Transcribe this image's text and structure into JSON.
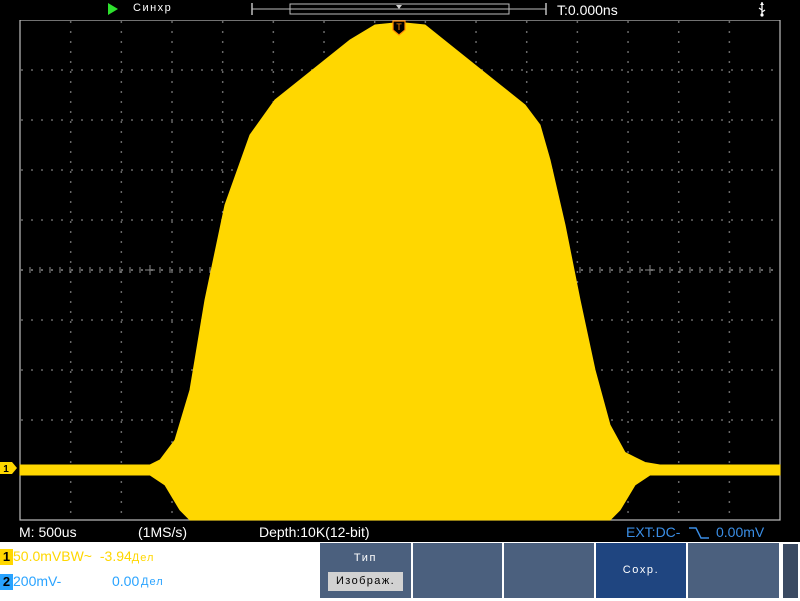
{
  "top": {
    "trigger_status": "Синхр",
    "time_offset": "T:0.000ns",
    "run_state_icon": "run-play-icon",
    "usb_icon": "usb-icon"
  },
  "markers": {
    "trigger_level": "T",
    "channel_ref": "1"
  },
  "colors": {
    "ch1": "#ffd700",
    "ch2": "#29a3ff",
    "ext": "#3a8ee6",
    "menu_bg": "#4b607e",
    "menu_selected": "#1f4580",
    "grid": "#8a8a8a"
  },
  "waveform": {
    "channel": 1,
    "baseline_div": -4,
    "baseline_noise_div": 0.1,
    "envelope_upper": [
      [
        -7.6,
        -3.9
      ],
      [
        -5.0,
        -3.9
      ],
      [
        -4.8,
        -3.8
      ],
      [
        -4.5,
        -3.4
      ],
      [
        -4.2,
        -2.4
      ],
      [
        -3.9,
        -0.6
      ],
      [
        -3.5,
        1.3
      ],
      [
        -3.0,
        2.7
      ],
      [
        -2.5,
        3.4
      ],
      [
        -2.0,
        3.8
      ],
      [
        -1.5,
        4.2
      ],
      [
        -1.0,
        4.6
      ],
      [
        -0.5,
        4.9
      ],
      [
        0.0,
        4.95
      ],
      [
        0.5,
        4.9
      ],
      [
        1.0,
        4.5
      ],
      [
        1.5,
        4.1
      ],
      [
        2.0,
        3.7
      ],
      [
        2.5,
        3.3
      ],
      [
        2.8,
        2.9
      ],
      [
        3.0,
        2.2
      ],
      [
        3.3,
        0.9
      ],
      [
        3.6,
        -0.6
      ],
      [
        3.9,
        -2.0
      ],
      [
        4.2,
        -3.1
      ],
      [
        4.5,
        -3.65
      ],
      [
        4.9,
        -3.85
      ],
      [
        5.2,
        -3.9
      ],
      [
        7.6,
        -3.9
      ]
    ],
    "envelope_lower": [
      [
        -7.6,
        -4.1
      ],
      [
        -5.0,
        -4.1
      ],
      [
        -4.7,
        -4.3
      ],
      [
        -4.4,
        -4.8
      ],
      [
        -4.2,
        -5.0
      ],
      [
        4.2,
        -5.0
      ],
      [
        4.4,
        -4.8
      ],
      [
        4.7,
        -4.3
      ],
      [
        5.0,
        -4.1
      ],
      [
        7.6,
        -4.1
      ]
    ]
  },
  "status": {
    "timebase": "M: 500us",
    "sample_rate": "(1MS/s)",
    "depth": "Depth:10K(12-bit)",
    "trigger_source": "EXT:DC-",
    "trigger_level": "0.00mV"
  },
  "channels": [
    {
      "num": "1",
      "scale": "50.0mV",
      "coupling": "BW~",
      "offset": "-3.94",
      "offset_unit": "Дел"
    },
    {
      "num": "2",
      "scale": "200mV-",
      "coupling": "",
      "offset": "0.00",
      "offset_unit": "Дел"
    }
  ],
  "menu": {
    "items": [
      {
        "label": "Тип",
        "value": "Изображ."
      },
      {
        "label": "",
        "value": ""
      },
      {
        "label": "",
        "value": ""
      },
      {
        "label": "Сохр.",
        "value": ""
      },
      {
        "label": "",
        "value": ""
      }
    ]
  }
}
